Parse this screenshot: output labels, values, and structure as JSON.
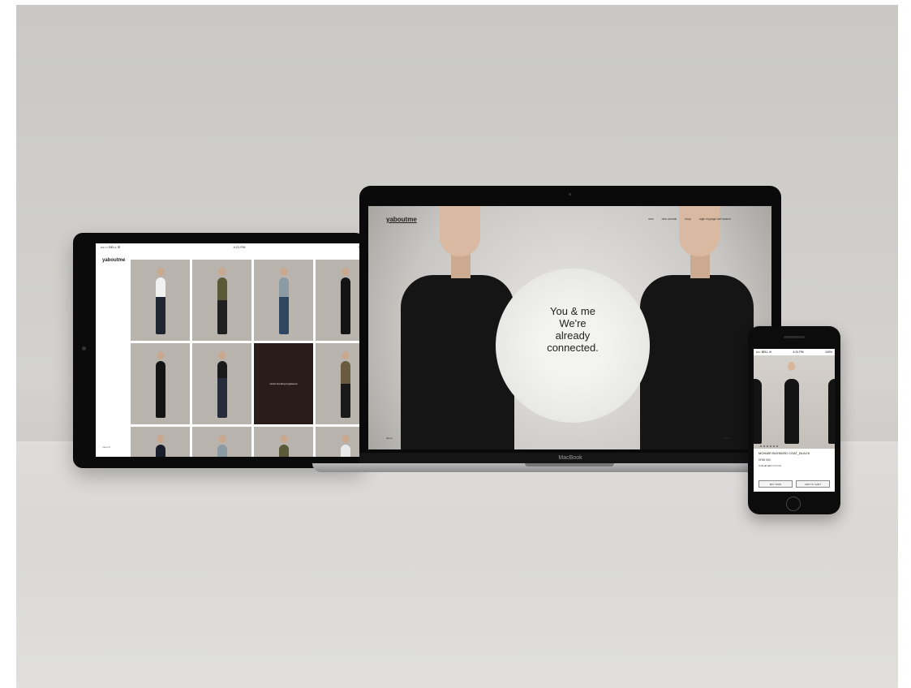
{
  "ipad": {
    "status_left": "•••○○ BELL ✉",
    "status_time": "4:21 PM",
    "status_right": "≡",
    "logo": "yaboutme",
    "menu": "menu ≡",
    "tile_caption": "velvet bonding longsleeve"
  },
  "laptop": {
    "logo": "yaboutme",
    "nav": [
      "new",
      "new arrivals",
      "shop",
      "login  mypage  cart  search"
    ],
    "hero_lines": [
      "You & me",
      "We're",
      "already",
      "connected."
    ],
    "footer_left": "about",
    "footer_right": "fashion",
    "brand": "MacBook"
  },
  "phone": {
    "status_left": "•••○ BELL ✉",
    "status_time": "4:21 PM",
    "status_right": "100%",
    "product_name": "MOHAIR BLENDED COAT_BLACK",
    "price": "KRW 000",
    "options": "SIZE  ■S  ■M        COLOR",
    "btn_buy": "BUY NOW",
    "btn_cart": "ADD TO CART"
  },
  "colors": {
    "coat": "#141414",
    "olive": "#5a5a3a",
    "denim": "#2f4660"
  }
}
